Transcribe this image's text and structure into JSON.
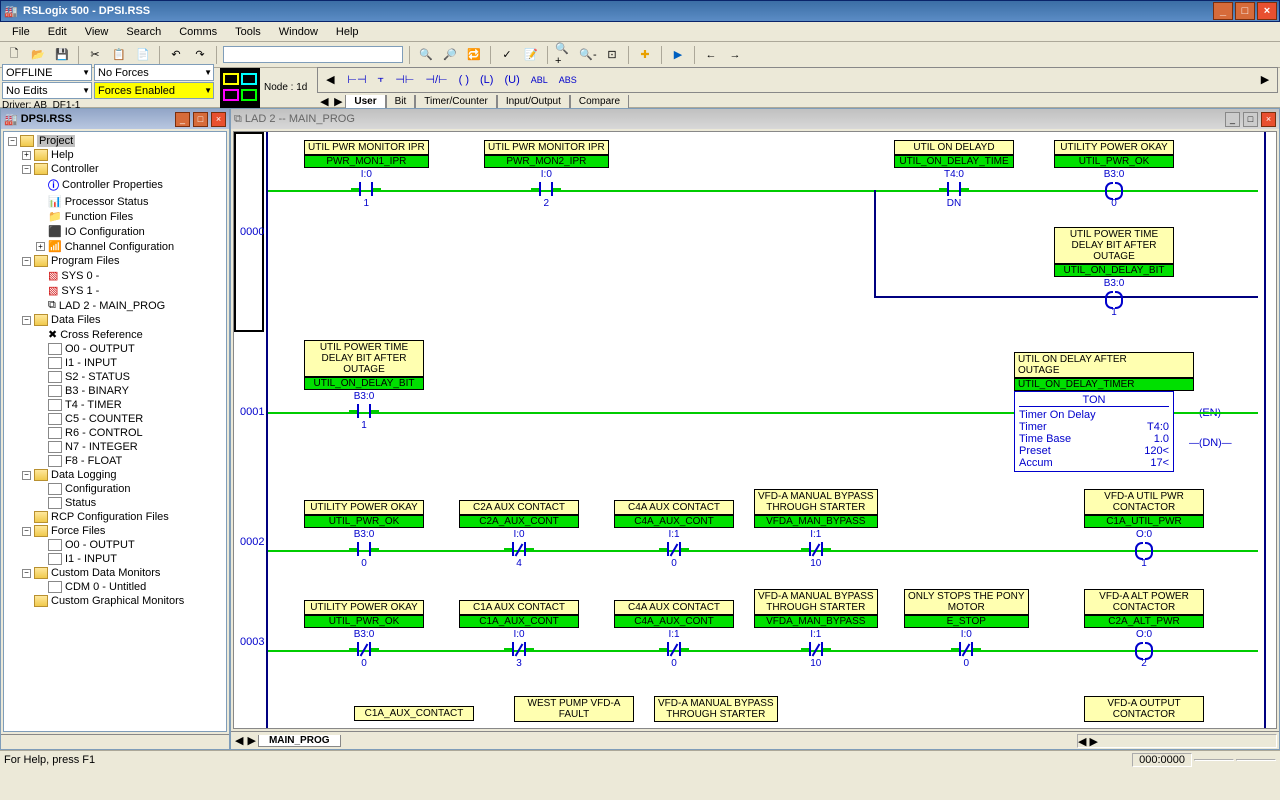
{
  "window": {
    "title": "RSLogix 500 - DPSI.RSS"
  },
  "menu": [
    "File",
    "Edit",
    "View",
    "Search",
    "Comms",
    "Tools",
    "Window",
    "Help"
  ],
  "status": {
    "mode": "OFFLINE",
    "forces1": "No Forces",
    "edits": "No Edits",
    "forces2": "Forces Enabled",
    "driver": "Driver: AB_DF1-1",
    "node": "Node : 1d"
  },
  "instr_tabs": [
    "User",
    "Bit",
    "Timer/Counter",
    "Input/Output",
    "Compare"
  ],
  "tree_title": "DPSI.RSS",
  "tree": {
    "root": "Project",
    "items": [
      "Help",
      "Controller",
      "Controller Properties",
      "Processor Status",
      "Function Files",
      "IO Configuration",
      "Channel Configuration",
      "Program Files",
      "SYS 0 -",
      "SYS 1 -",
      "LAD 2 - MAIN_PROG",
      "Data Files",
      "Cross Reference",
      "O0 - OUTPUT",
      "I1 - INPUT",
      "S2 - STATUS",
      "B3 - BINARY",
      "T4 - TIMER",
      "C5 - COUNTER",
      "R6 - CONTROL",
      "N7 - INTEGER",
      "F8 - FLOAT",
      "Data Logging",
      "Configuration",
      "Status",
      "RCP Configuration Files",
      "Force Files",
      "O0 - OUTPUT",
      "I1 - INPUT",
      "Custom Data Monitors",
      "CDM 0 - Untitled",
      "Custom Graphical Monitors"
    ]
  },
  "ladder_title": "LAD 2 -- MAIN_PROG",
  "ladder_tab": "MAIN_PROG",
  "rungs": {
    "r0": {
      "num": "0000",
      "c1": {
        "label": "UTIL PWR MONITOR IPR",
        "tag": "PWR_MON1_IPR",
        "addr": "I:0",
        "term": "1"
      },
      "c2": {
        "label": "UTIL PWR MONITOR IPR",
        "tag": "PWR_MON2_IPR",
        "addr": "I:0",
        "term": "2"
      },
      "c3": {
        "label": "UTIL ON DELAYD",
        "tag": "UTIL_ON_DELAY_TIME",
        "addr": "T4:0",
        "term": "DN"
      },
      "o1": {
        "label": "UTILITY POWER OKAY",
        "tag": "UTIL_PWR_OK",
        "addr": "B3:0",
        "term": "0"
      },
      "o2": {
        "label": "UTIL POWER TIME\nDELAY BIT AFTER\nOUTAGE",
        "tag": "UTIL_ON_DELAY_BIT",
        "addr": "B3:0",
        "term": "1"
      }
    },
    "r1": {
      "num": "0001",
      "c1": {
        "label": "UTIL POWER TIME\nDELAY BIT AFTER\nOUTAGE",
        "tag": "UTIL_ON_DELAY_BIT",
        "addr": "B3:0",
        "term": "1"
      },
      "o1": {
        "label": "UTIL ON DELAY AFTER\nOUTAGE",
        "tag": "UTIL_ON_DELAY_TIMER"
      },
      "ton": {
        "title": "TON",
        "line1": "Timer On Delay",
        "timer_l": "Timer",
        "timer_v": "T4:0",
        "tb_l": "Time Base",
        "tb_v": "1.0",
        "pre_l": "Preset",
        "pre_v": "120<",
        "acc_l": "Accum",
        "acc_v": "17<",
        "en": "EN",
        "dn": "DN"
      }
    },
    "r2": {
      "num": "0002",
      "c1": {
        "label": "UTILITY POWER OKAY",
        "tag": "UTIL_PWR_OK",
        "addr": "B3:0",
        "term": "0"
      },
      "c2": {
        "label": "C2A AUX CONTACT",
        "tag": "C2A_AUX_CONT",
        "addr": "I:0",
        "term": "4"
      },
      "c3": {
        "label": "C4A AUX CONTACT",
        "tag": "C4A_AUX_CONT",
        "addr": "I:1",
        "term": "0"
      },
      "c4": {
        "label": "VFD-A MANUAL BYPASS\nTHROUGH STARTER",
        "tag": "VFDA_MAN_BYPASS",
        "addr": "I:1",
        "term": "10"
      },
      "o1": {
        "label": "VFD-A UTIL PWR\nCONTACTOR",
        "tag": "C1A_UTIL_PWR",
        "addr": "O:0",
        "term": "1"
      }
    },
    "r3": {
      "num": "0003",
      "c1": {
        "label": "UTILITY POWER OKAY",
        "tag": "UTIL_PWR_OK",
        "addr": "B3:0",
        "term": "0"
      },
      "c2": {
        "label": "C1A AUX CONTACT",
        "tag": "C1A_AUX_CONT",
        "addr": "I:0",
        "term": "3"
      },
      "c3": {
        "label": "C4A AUX CONTACT",
        "tag": "C4A_AUX_CONT",
        "addr": "I:1",
        "term": "0"
      },
      "c4": {
        "label": "VFD-A MANUAL BYPASS\nTHROUGH STARTER",
        "tag": "VFDA_MAN_BYPASS",
        "addr": "I:1",
        "term": "10"
      },
      "c5": {
        "label": "ONLY STOPS THE PONY\nMOTOR",
        "tag": "E_STOP",
        "addr": "I:0",
        "term": "0"
      },
      "o1": {
        "label": "VFD-A ALT POWER\nCONTACTOR",
        "tag": "C2A_ALT_PWR",
        "addr": "O:0",
        "term": "2"
      }
    },
    "r4": {
      "c1": {
        "tag": "C1A_AUX_CONTACT"
      },
      "c2": {
        "label": "WEST PUMP VFD-A\nFAULT"
      },
      "c3": {
        "label": "VFD-A MANUAL BYPASS\nTHROUGH STARTER"
      },
      "o1": {
        "label": "VFD-A OUTPUT\nCONTACTOR"
      }
    }
  },
  "statusbar": {
    "help": "For Help, press F1",
    "pos": "000:0000"
  }
}
